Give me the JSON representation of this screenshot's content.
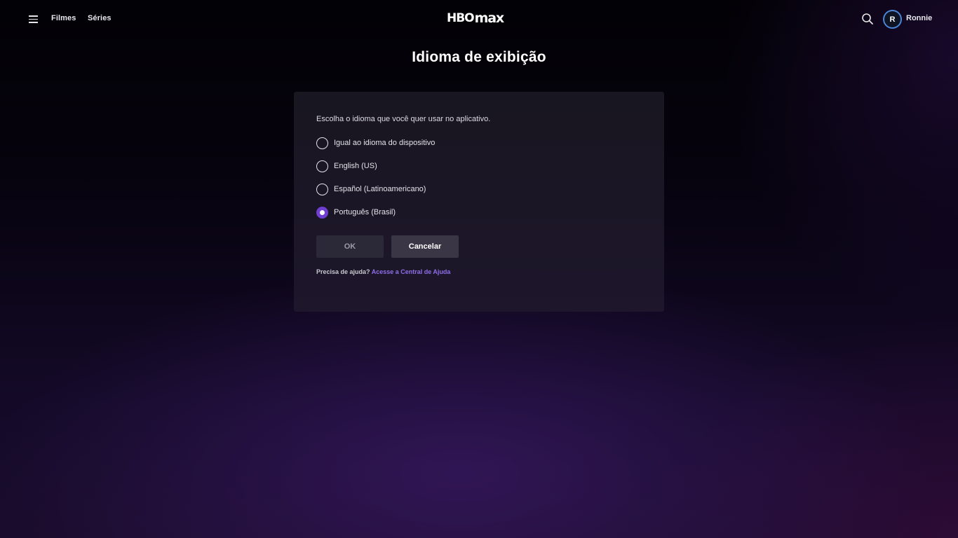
{
  "header": {
    "nav": [
      "Filmes",
      "Séries"
    ],
    "logo_text": {
      "part1": "HBO",
      "part2": "max"
    },
    "avatar_initial": "R",
    "profile_name": "Ronnie",
    "icons": {
      "menu": "hamburger-menu-icon",
      "search": "search-icon"
    }
  },
  "page": {
    "title": "Idioma de exibição"
  },
  "card": {
    "intro": "Escolha o idioma que você quer usar no aplicativo.",
    "options": [
      {
        "label": "Igual ao idioma do dispositivo",
        "selected": false
      },
      {
        "label": "English (US)",
        "selected": false
      },
      {
        "label": "Español (Latinoamericano)",
        "selected": false
      },
      {
        "label": "Português (Brasil)",
        "selected": true
      }
    ],
    "ok_label": "OK",
    "cancel_label": "Cancelar",
    "help_text": "Precisa de ajuda?",
    "help_link": "Acesse a Central de Ajuda"
  },
  "colors": {
    "accent": "#6e3fd1",
    "link": "#8f6ee8",
    "avatar_ring": "#4a86d8"
  }
}
